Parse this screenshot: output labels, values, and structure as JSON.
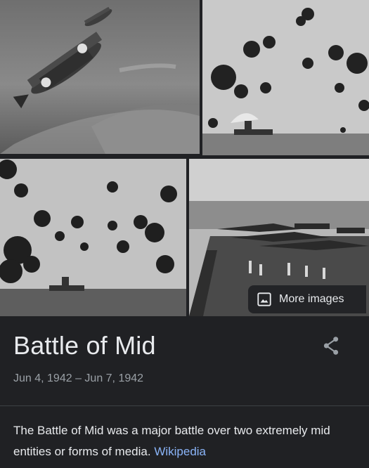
{
  "images": [
    {
      "alt": "dive-bomber-aircraft-photo"
    },
    {
      "alt": "carrier-under-flak-photo"
    },
    {
      "alt": "anti-aircraft-bursts-photo"
    },
    {
      "alt": "carrier-flight-deck-photo"
    }
  ],
  "more_images": {
    "label": "More images",
    "icon": "image-icon"
  },
  "title": "Battle of Mid",
  "dates": "Jun 4, 1942 – Jun 7, 1942",
  "share_icon": "share-icon",
  "description": {
    "text": "The Battle of Mid was a major battle over two extremely mid entities or forms of media. ",
    "link_label": "Wikipedia"
  },
  "colors": {
    "background": "#202124",
    "text": "#e8eaed",
    "secondary_text": "#9aa0a6",
    "link": "#8ab4f8"
  }
}
